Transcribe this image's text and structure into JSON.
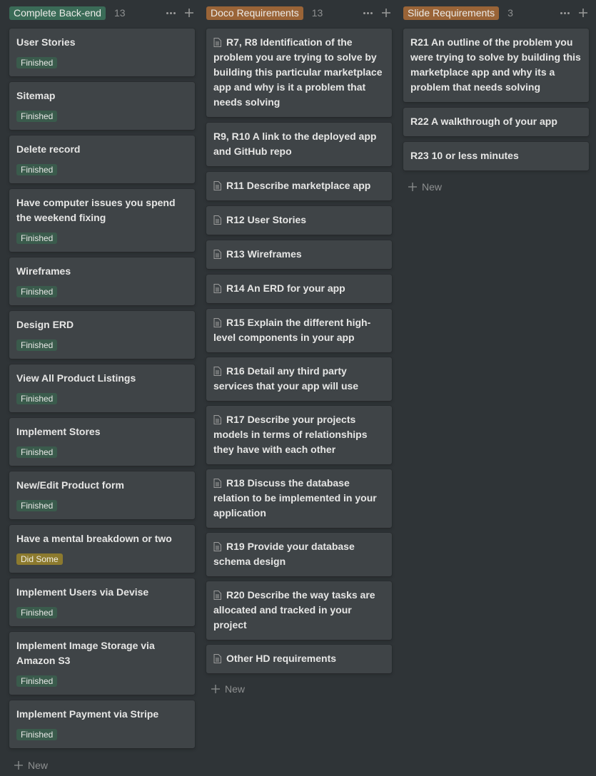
{
  "columns": [
    {
      "tag": "Complete Back-end",
      "tag_color": "#3a6b57",
      "count": "13",
      "new_label": "New",
      "cards": [
        {
          "title": "User Stories",
          "badge": "Finished"
        },
        {
          "title": "Sitemap",
          "badge": "Finished"
        },
        {
          "title": "Delete record",
          "badge": "Finished"
        },
        {
          "title": "Have computer issues you spend the weekend fixing",
          "badge": "Finished"
        },
        {
          "title": "Wireframes",
          "badge": "Finished"
        },
        {
          "title": "Design ERD",
          "badge": "Finished"
        },
        {
          "title": "View All Product Listings",
          "badge": "Finished"
        },
        {
          "title": "Implement Stores",
          "badge": "Finished"
        },
        {
          "title": "New/Edit Product form",
          "badge": "Finished"
        },
        {
          "title": "Have a mental breakdown or two",
          "badge": "Did Some"
        },
        {
          "title": "Implement Users via Devise",
          "badge": "Finished"
        },
        {
          "title": "Implement Image Storage via Amazon S3",
          "badge": "Finished"
        },
        {
          "title": "Implement Payment via Stripe",
          "badge": "Finished"
        }
      ]
    },
    {
      "tag": "Doco Requirements",
      "tag_color": "#9a6437",
      "count": "13",
      "new_label": "New",
      "cards": [
        {
          "title": "R7, R8 Identification of the problem you are trying to solve by building this particular marketplace app and why is it a problem that needs solving"
        },
        {
          "title": "R9, R10 A link to the deployed app and GitHub repo"
        },
        {
          "title": "R11 Describe marketplace app"
        },
        {
          "title": "R12 User Stories"
        },
        {
          "title": "R13 Wireframes"
        },
        {
          "title": "R14 An ERD for your app"
        },
        {
          "title": "R15 Explain the different high-level components in your app"
        },
        {
          "title": "R16 Detail any third party services that your app will use"
        },
        {
          "title": "R17 Describe your projects models in terms of relationships they have with each other"
        },
        {
          "title": "R18 Discuss the database relation to be implemented in your application"
        },
        {
          "title": "R19 Provide your database schema design"
        },
        {
          "title": "R20 Describe the way tasks are allocated and tracked in your project"
        },
        {
          "title": "Other HD requirements"
        }
      ]
    },
    {
      "tag": "Slide Requirements",
      "tag_color": "#9a6437",
      "count": "3",
      "new_label": "New",
      "cards": [
        {
          "title": "R21 An outline of the problem you were trying to solve by building this marketplace app and why its a problem that needs solving"
        },
        {
          "title": "R22 A walkthrough of your app"
        },
        {
          "title": "R23 10 or less minutes"
        }
      ]
    }
  ],
  "badge_colors": {
    "Finished": "#3a5b4c",
    "Did Some": "#8c7a2e"
  }
}
